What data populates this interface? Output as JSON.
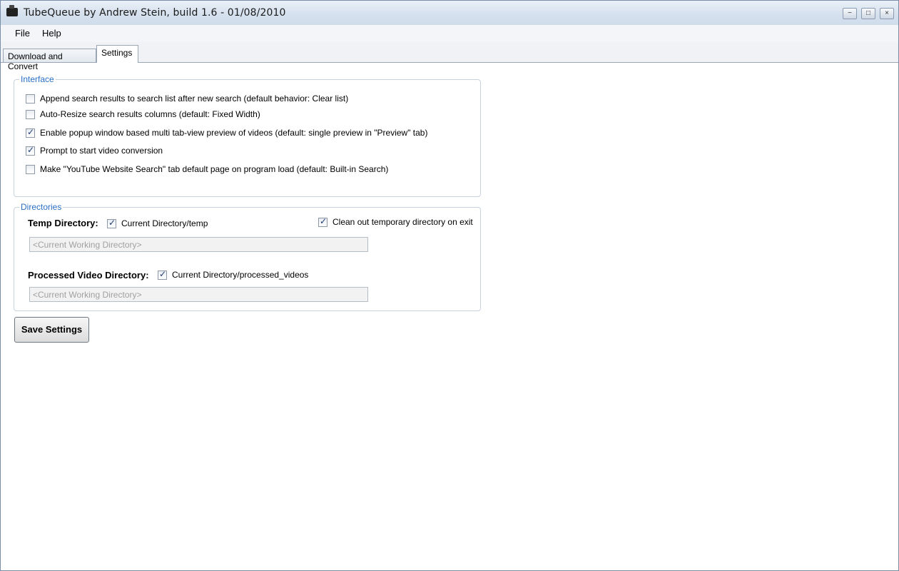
{
  "window": {
    "title": "TubeQueue by Andrew Stein, build 1.6 - 01/08/2010",
    "controls": {
      "minimize": "−",
      "maximize": "□",
      "close": "×"
    }
  },
  "menu": {
    "items": [
      "File",
      "Help"
    ]
  },
  "tabs": [
    {
      "label": "Download and Convert",
      "active": false
    },
    {
      "label": "Settings",
      "active": true
    }
  ],
  "interface": {
    "legend": "Interface",
    "options": [
      {
        "label": "Append search results to search list after new search (default behavior: Clear list)",
        "checked": false
      },
      {
        "label": "Auto-Resize search results columns (default: Fixed Width)",
        "checked": false
      },
      {
        "label": "Enable popup window based multi tab-view preview of videos (default: single preview in \"Preview\" tab)",
        "checked": true
      },
      {
        "label": "Prompt to start video conversion",
        "checked": true
      },
      {
        "label": "Make \"YouTube Website Search\" tab default page on program load (default: Built-in Search)",
        "checked": false
      }
    ]
  },
  "directories": {
    "legend": "Directories",
    "temp_label": "Temp Directory:",
    "temp_checkbox": {
      "label": "Current Directory/temp",
      "checked": true
    },
    "clean_checkbox": {
      "label": "Clean out temporary directory on exit",
      "checked": true
    },
    "temp_path": "<Current Working Directory>",
    "processed_label": "Processed Video Directory:",
    "processed_checkbox": {
      "label": "Current Directory/processed_videos",
      "checked": true
    },
    "processed_path": "<Current Working Directory>"
  },
  "save_button": "Save Settings"
}
